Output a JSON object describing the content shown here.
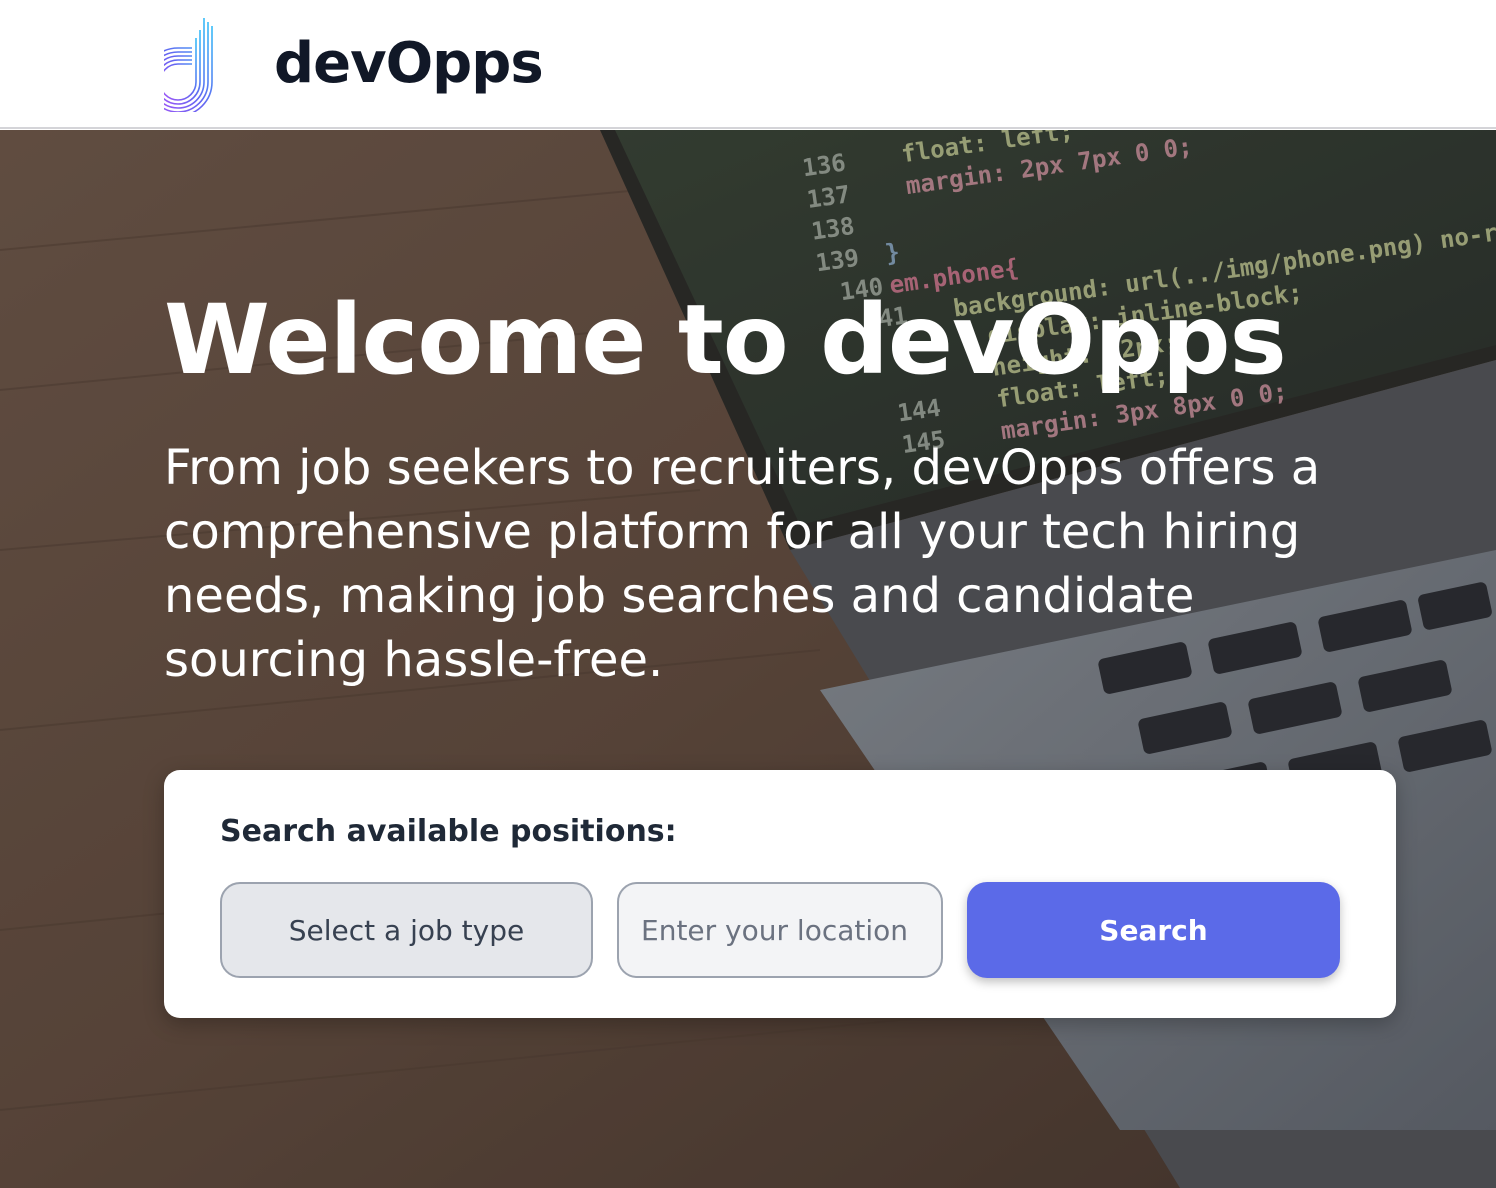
{
  "brand": {
    "name": "devOpps",
    "logo_icon": "devopps-logo-icon",
    "logo_colors": [
      "#38bdf8",
      "#6366f1",
      "#a855f7",
      "#ec4899"
    ]
  },
  "hero": {
    "title": "Welcome to devOpps",
    "subtitle": "From job seekers to recruiters, devOpps offers a comprehensive platform for all your tech hiring needs, making job searches and candidate sourcing hassle-free.",
    "background_image": "laptop-with-code-photo"
  },
  "search": {
    "heading": "Search available positions:",
    "job_type_label": "Select a job type",
    "location_placeholder": "Enter your location",
    "location_value": "",
    "button_label": "Search"
  },
  "colors": {
    "accent": "#5b6ae8",
    "text_dark": "#111827",
    "white": "#ffffff"
  }
}
